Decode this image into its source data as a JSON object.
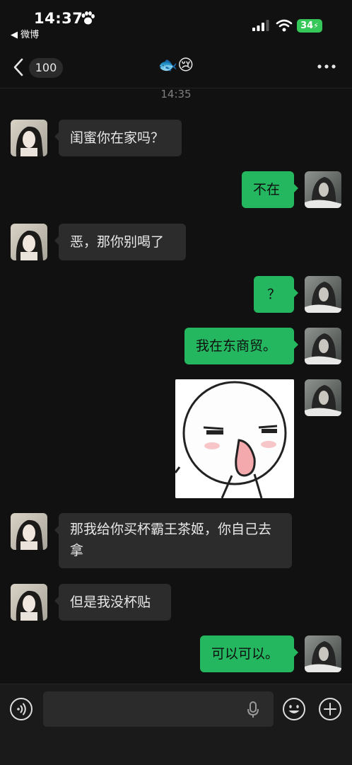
{
  "status_bar": {
    "time": "14:37",
    "back_app": "◀ 微博",
    "battery": "34"
  },
  "nav": {
    "unread_count": "100",
    "title": "🐟😢"
  },
  "chat": {
    "timestamp": "14:35",
    "messages": [
      {
        "side": "in",
        "text": "闺蜜你在家吗？"
      },
      {
        "side": "out",
        "text": "不在"
      },
      {
        "side": "in",
        "text": "恶，那你别喝了"
      },
      {
        "side": "out",
        "text": "？"
      },
      {
        "side": "out",
        "text": "我在东商贸。"
      },
      {
        "side": "out",
        "type": "sticker"
      },
      {
        "side": "in",
        "text": "那我给你买杯霸王茶姬，你自己去拿"
      },
      {
        "side": "in",
        "text": "但是我没杯贴"
      },
      {
        "side": "out",
        "text": "可以可以。"
      }
    ]
  },
  "input_bar": {
    "placeholder": "",
    "icons": [
      "voice-icon",
      "microphone-icon",
      "emoji-icon",
      "plus-icon"
    ]
  },
  "colors": {
    "background": "#111111",
    "bubble_in": "#2c2c2c",
    "bubble_out": "#25b760",
    "battery": "#35c759"
  }
}
